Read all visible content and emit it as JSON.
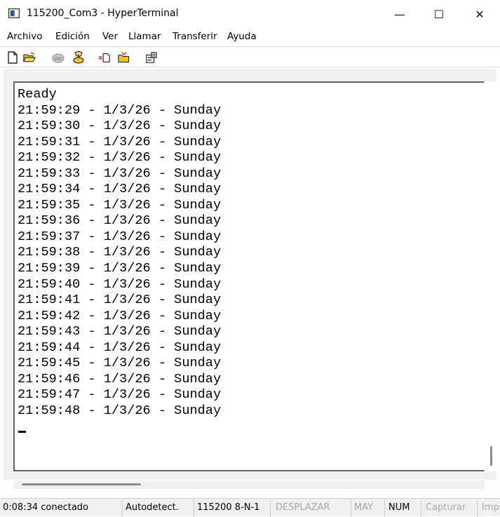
{
  "window": {
    "title": "115200_Com3 - HyperTerminal",
    "minimize": "—",
    "maximize": "☐",
    "close": "✕"
  },
  "menu": [
    "Archivo",
    "Edición",
    "Ver",
    "Llamar",
    "Transferir",
    "Ayuda"
  ],
  "toolbar": {
    "icons": [
      "new-document-icon",
      "open-folder-icon",
      "connect-phone-icon",
      "disconnect-icon",
      "send-file-icon",
      "receive-file-icon",
      "properties-icon"
    ]
  },
  "terminal": {
    "lines": [
      "Ready",
      "21:59:29 - 1/3/26 - Sunday",
      "21:59:30 - 1/3/26 - Sunday",
      "21:59:31 - 1/3/26 - Sunday",
      "21:59:32 - 1/3/26 - Sunday",
      "21:59:33 - 1/3/26 - Sunday",
      "21:59:34 - 1/3/26 - Sunday",
      "21:59:35 - 1/3/26 - Sunday",
      "21:59:36 - 1/3/26 - Sunday",
      "21:59:37 - 1/3/26 - Sunday",
      "21:59:38 - 1/3/26 - Sunday",
      "21:59:39 - 1/3/26 - Sunday",
      "21:59:40 - 1/3/26 - Sunday",
      "21:59:41 - 1/3/26 - Sunday",
      "21:59:42 - 1/3/26 - Sunday",
      "21:59:43 - 1/3/26 - Sunday",
      "21:59:44 - 1/3/26 - Sunday",
      "21:59:45 - 1/3/26 - Sunday",
      "21:59:46 - 1/3/26 - Sunday",
      "21:59:47 - 1/3/26 - Sunday",
      "21:59:48 - 1/3/26 - Sunday"
    ]
  },
  "status": {
    "connection": "0:08:34 conectado",
    "detect": "Autodetect.",
    "settings": "115200 8-N-1",
    "scroll": "DESPLAZAR",
    "caps": "MAY",
    "num": "NUM",
    "capture": "Capturar",
    "print": "Imp"
  }
}
